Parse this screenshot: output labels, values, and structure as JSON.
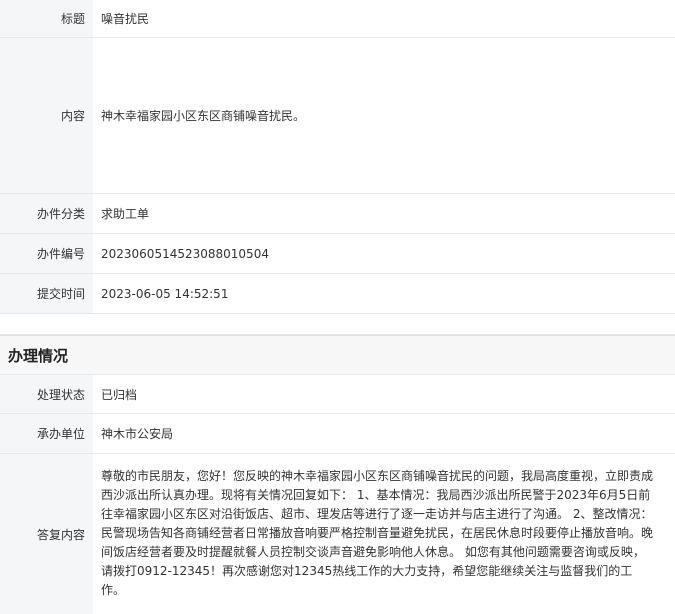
{
  "detail": {
    "title_label": "标题",
    "title_value": "噪音扰民",
    "content_label": "内容",
    "content_value": "神木幸福家园小区东区商铺噪音扰民。",
    "category_label": "办件分类",
    "category_value": "求助工单",
    "number_label": "办件编号",
    "number_value": "2023060514523088010504",
    "time_label": "提交时间",
    "time_value": "2023-06-05 14:52:51"
  },
  "processing": {
    "section_title": "办理情况",
    "status_label": "处理状态",
    "status_value": "已归档",
    "unit_label": "承办单位",
    "unit_value": "神木市公安局",
    "reply_label": "答复内容",
    "reply_value": "尊敬的市民朋友，您好！您反映的神木幸福家园小区东区商铺噪音扰民的问题，我局高度重视，立即责成西沙派出所认真办理。现将有关情况回复如下： 1、基本情况：我局西沙派出所民警于2023年6月5日前往幸福家园小区东区对沿街饭店、超市、理发店等进行了逐一走访并与店主进行了沟通。 2、整改情况：民警现场告知各商铺经营者日常播放音响要严格控制音量避免扰民，在居民休息时段要停止播放音响。晚间饭店经营者要及时提醒就餐人员控制交谈声音避免影响他人休息。 如您有其他问题需要咨询或反映，请拨打0912-12345！再次感谢您对12345热线工作的大力支持，希望您能继续关注与监督我们的工作。"
  }
}
